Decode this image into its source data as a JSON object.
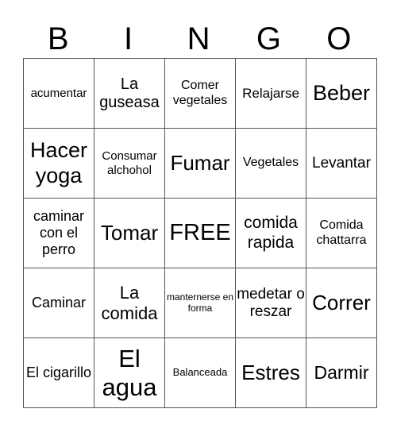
{
  "title_letters": [
    "B",
    "I",
    "N",
    "G",
    "O"
  ],
  "rows": [
    [
      {
        "t": "acumentar",
        "s": 15
      },
      {
        "t": "La guseasa",
        "s": 20
      },
      {
        "t": "Comer vegetales",
        "s": 16
      },
      {
        "t": "Relajarse",
        "s": 17
      },
      {
        "t": "Beber",
        "s": 27
      }
    ],
    [
      {
        "t": "Hacer yoga",
        "s": 27
      },
      {
        "t": "Consumar alchohol",
        "s": 15
      },
      {
        "t": "Fumar",
        "s": 26
      },
      {
        "t": "Vegetales",
        "s": 16
      },
      {
        "t": "Levantar",
        "s": 19
      }
    ],
    [
      {
        "t": "caminar con el perro",
        "s": 18
      },
      {
        "t": "Tomar",
        "s": 26
      },
      {
        "t": "FREE",
        "s": 29
      },
      {
        "t": "comida rapida",
        "s": 21
      },
      {
        "t": "Comida chattarra",
        "s": 16
      }
    ],
    [
      {
        "t": "Caminar",
        "s": 18
      },
      {
        "t": "La comida",
        "s": 22
      },
      {
        "t": "manternerse en forma",
        "s": 12
      },
      {
        "t": "medetar o reszar",
        "s": 19
      },
      {
        "t": "Correr",
        "s": 26
      }
    ],
    [
      {
        "t": "El cigarillo",
        "s": 18
      },
      {
        "t": "El agua",
        "s": 31
      },
      {
        "t": "Balanceada",
        "s": 13
      },
      {
        "t": "Estres",
        "s": 26
      },
      {
        "t": "Darmir",
        "s": 23
      }
    ]
  ]
}
